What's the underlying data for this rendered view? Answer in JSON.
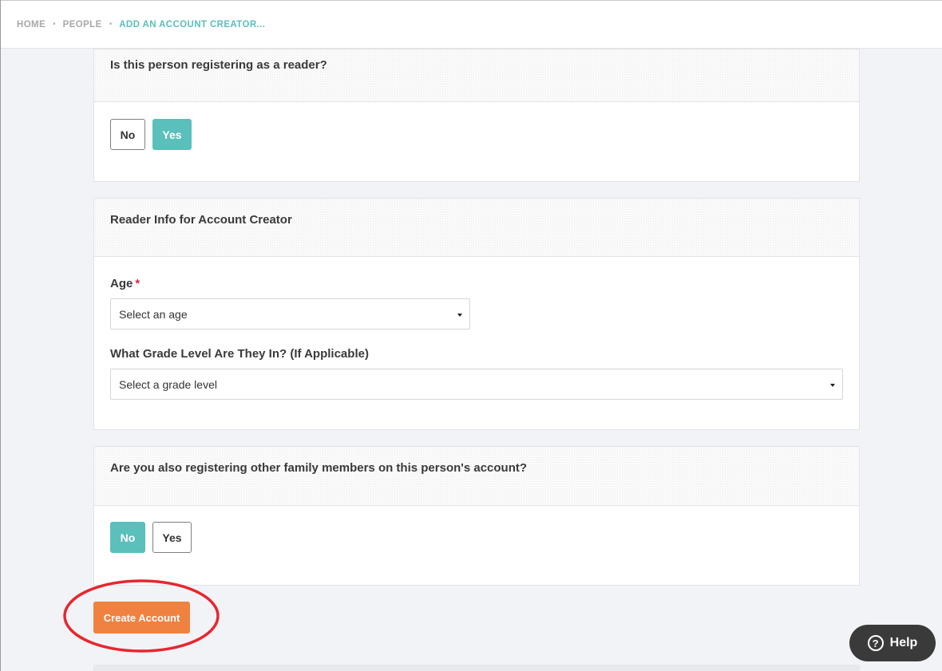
{
  "breadcrumb": {
    "home": "HOME",
    "people": "PEOPLE",
    "current": "ADD AN ACCOUNT CREATOR...",
    "separator": "•"
  },
  "reader_question": {
    "title": "Is this person registering as a reader?",
    "no_label": "No",
    "yes_label": "Yes",
    "selected": "Yes"
  },
  "reader_info": {
    "title": "Reader Info for Account Creator",
    "age_label": "Age",
    "required_mark": "*",
    "age_value": "Select an age",
    "grade_label": "What Grade Level Are They In? (If Applicable)",
    "grade_value": "Select a grade level"
  },
  "family_question": {
    "title": "Are you also registering other family members on this person's account?",
    "no_label": "No",
    "yes_label": "Yes",
    "selected": "No"
  },
  "actions": {
    "create_account": "Create Account",
    "help": "Help",
    "help_icon": "question-circle-icon"
  },
  "colors": {
    "accent_teal": "#5bbfbb",
    "primary_orange": "#ef8240",
    "annotation_red": "#e8262f",
    "required_red": "#d9263e"
  }
}
